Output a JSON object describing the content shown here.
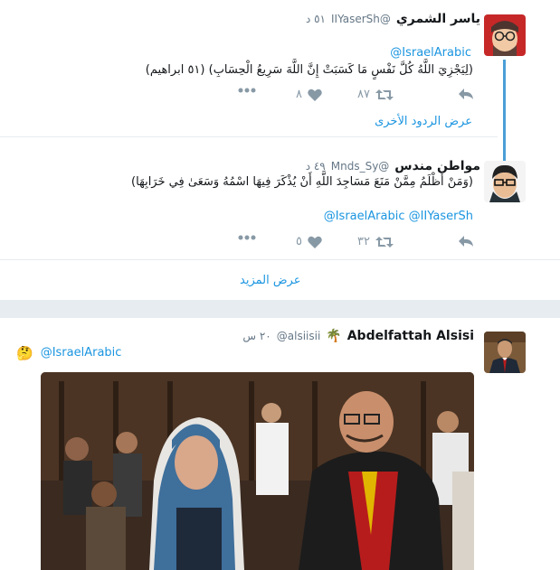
{
  "thread": {
    "tweet1": {
      "name": "ياسر الشمري",
      "handle": "@IIYaserSh",
      "time": "٥١ د",
      "mention": "@IsraelArabic",
      "text": "(لِيَجْزِيَ اللَّهُ كُلَّ نَفْسٍ مَا كَسَبَتْ إِنَّ اللَّهَ سَرِيعُ الْحِسَابِ) (٥١ ابراهيم)",
      "retweets": "٨٧",
      "likes": "٨",
      "show_other_replies": "عرض الردود الأخرى"
    },
    "tweet2": {
      "name": "مواطن مندس",
      "handle": "@Mnds_Sy",
      "time": "٤٩ د",
      "text": "(وَمَنْ أَظْلَمُ مِمَّنْ مَنَعَ مَسَاجِدَ اللَّهِ أَنْ يُذْكَرَ فِيهَا اسْمُهُ وَسَعَىٰ فِي خَرَابِهَا)",
      "mentions": "@IsraelArabic @IIYaserSh",
      "retweets": "٣٢",
      "likes": "٥"
    },
    "show_more": "عرض المزيد"
  },
  "tweet3": {
    "name": "Abdelfattah Alsisi",
    "name_emoji": "🌴",
    "handle": "@alsiisii",
    "time": "٢٠ س",
    "emoji": "🤔",
    "mention": "@IsraelArabic"
  },
  "colors": {
    "link": "#1b95e0",
    "action": "#8899a6",
    "thread_line": "#4a9ed6",
    "separator": "#e6ecf0"
  },
  "icons": [
    "reply-icon",
    "retweet-icon",
    "like-icon",
    "more-icon"
  ]
}
